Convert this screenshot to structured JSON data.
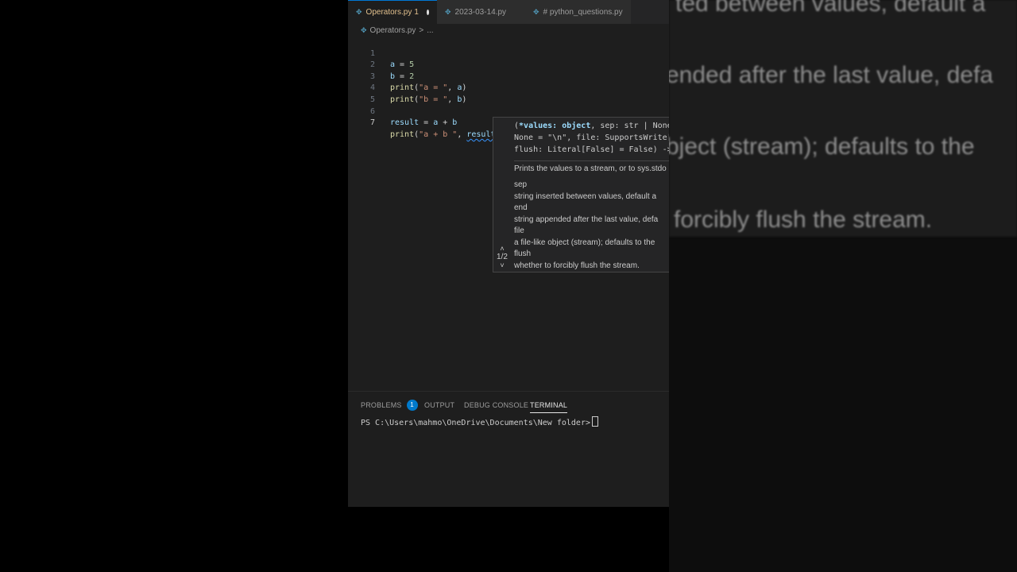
{
  "zoom": {
    "lines": [
      "ted between values, default a",
      "ended after the last value, defa",
      "bject (stream); defaults to the",
      "forcibly flush the stream."
    ]
  },
  "tabs": [
    {
      "icon": "python-file-icon",
      "label": "Operators.py",
      "problems": "1",
      "modified": true
    },
    {
      "icon": "python-file-icon",
      "label": "2023-03-14.py"
    },
    {
      "icon": "python-file-icon",
      "label": "# python_questions.py"
    }
  ],
  "breadcrumb": {
    "file": "Operators.py",
    "sep": ">",
    "rest": "..."
  },
  "code": {
    "line_numbers": [
      "1",
      "2",
      "3",
      "4",
      "5",
      "6",
      "7"
    ],
    "l1": {
      "var": "a",
      "op": " = ",
      "num": "5"
    },
    "l2": {
      "var": "b",
      "op": " = ",
      "num": "2"
    },
    "l3": {
      "fn": "print",
      "open": "(",
      "str": "\"a = \"",
      "comma": ", ",
      "arg": "a",
      "close": ")"
    },
    "l4": {
      "fn": "print",
      "open": "(",
      "str": "\"b = \"",
      "comma": ", ",
      "arg": "b",
      "close": ")"
    },
    "l6": {
      "var": "result",
      "op": " = ",
      "a": "a",
      "plus": " + ",
      "b": "b"
    },
    "l7": {
      "fn": "print",
      "open": "(",
      "str": "\"a + b \"",
      "comma": ", ",
      "arg": "result",
      "close": ")"
    }
  },
  "hover": {
    "sig1_open": "(",
    "sig1_param": "*values: object",
    "sig1_rest": ", sep: str | None",
    "sig2": "None = \"\\n\", file: SupportsWrite[s",
    "sig3": "flush: Literal[False] = False) ->",
    "summary": "Prints the values to a stream, or to sys.stdo",
    "params": [
      {
        "name": "sep",
        "desc": " string inserted between values, default a"
      },
      {
        "name": "end",
        "desc": " string appended after the last value, defa"
      },
      {
        "name": "file",
        "desc": " a file-like object (stream); defaults to the"
      },
      {
        "name": "flush",
        "desc": " whether to forcibly flush the stream."
      }
    ],
    "overload": "1/2"
  },
  "panel": {
    "tabs": [
      "PROBLEMS",
      "OUTPUT",
      "DEBUG CONSOLE",
      "TERMINAL"
    ],
    "problems_count": "1",
    "terminal_prompt": "PS C:\\Users\\mahmo\\OneDrive\\Documents\\New folder>"
  },
  "colors": {
    "accent": "#007acc",
    "keyword_var": "#9cdcfe",
    "function": "#dcdcaa",
    "string": "#ce9178",
    "number": "#b5cea8"
  }
}
